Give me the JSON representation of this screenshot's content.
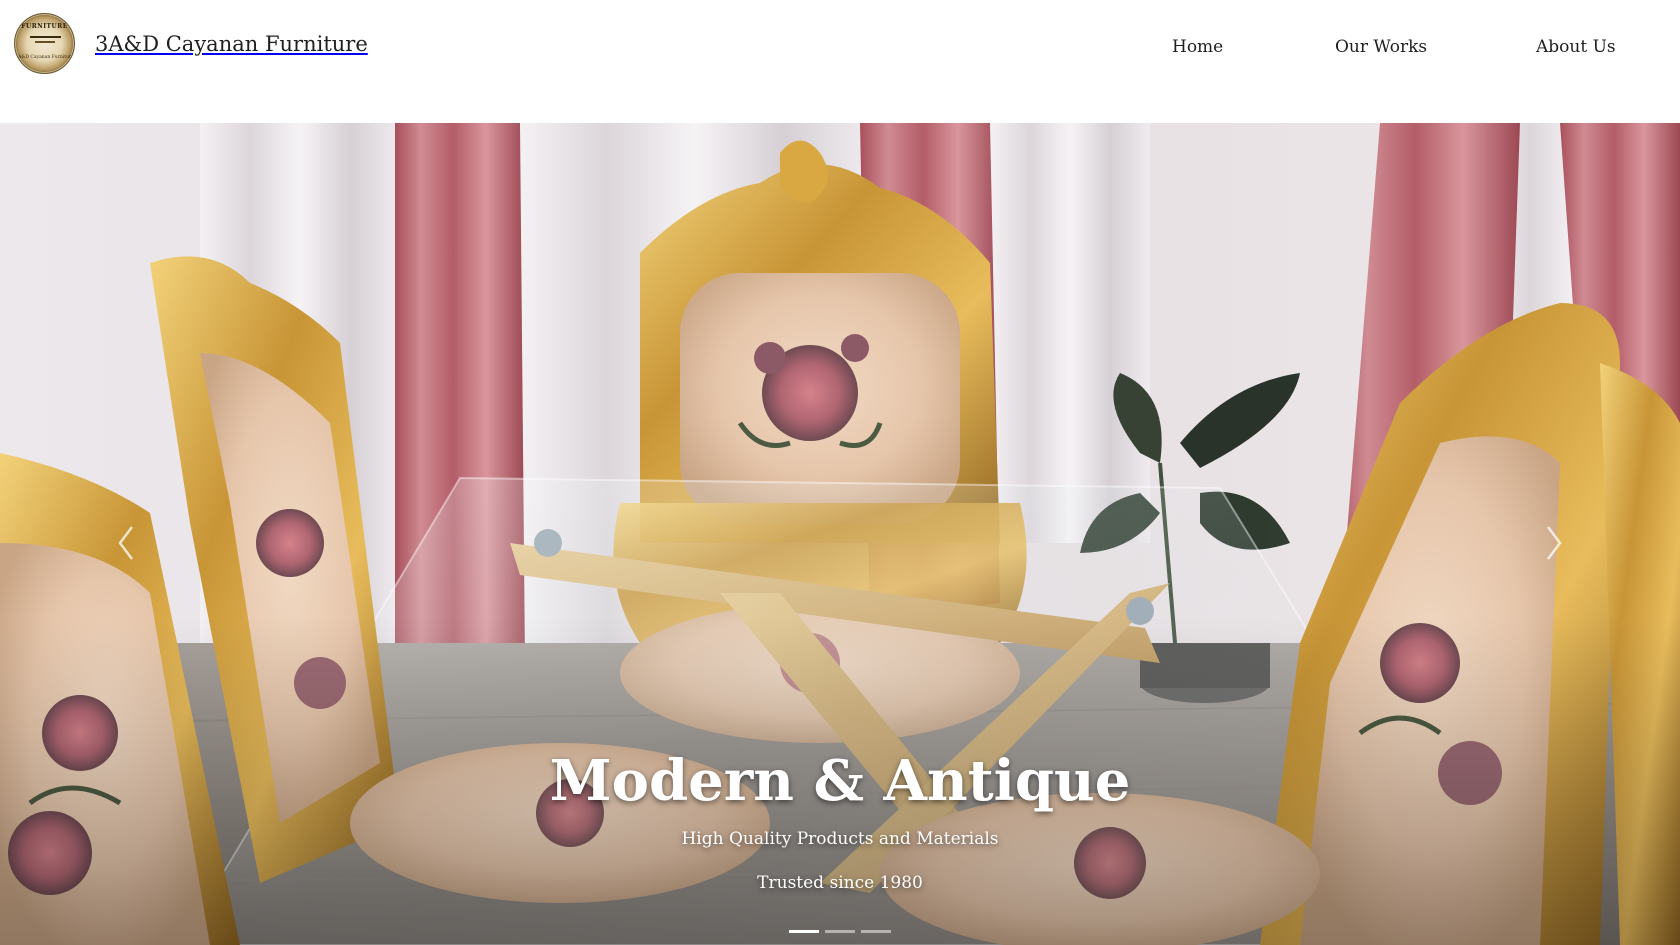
{
  "header": {
    "logo": {
      "icon": "round-furniture-seal-logo",
      "text_top": "FURNITURE",
      "text_sub": "3A&D Cayanan Furniture"
    },
    "brand_name": "3A&D Cayanan Furniture",
    "nav": [
      {
        "label": "Home"
      },
      {
        "label": "Our Works"
      },
      {
        "label": "About Us"
      }
    ]
  },
  "hero": {
    "image": "gold-baroque-dining-chairs-with-glass-table",
    "prev_icon": "chevron-left-icon",
    "next_icon": "chevron-right-icon",
    "title": "Modern & Antique",
    "subtitle": "High Quality Products and Materials",
    "tagline": "Trusted since 1980",
    "slides": 3,
    "active_slide": 1
  },
  "colors": {
    "background": "#ffffff",
    "text": "#1e1e1e",
    "caption_text": "#ffffff",
    "gold": "#c99a3a",
    "curtain_pink": "#c0727a"
  }
}
